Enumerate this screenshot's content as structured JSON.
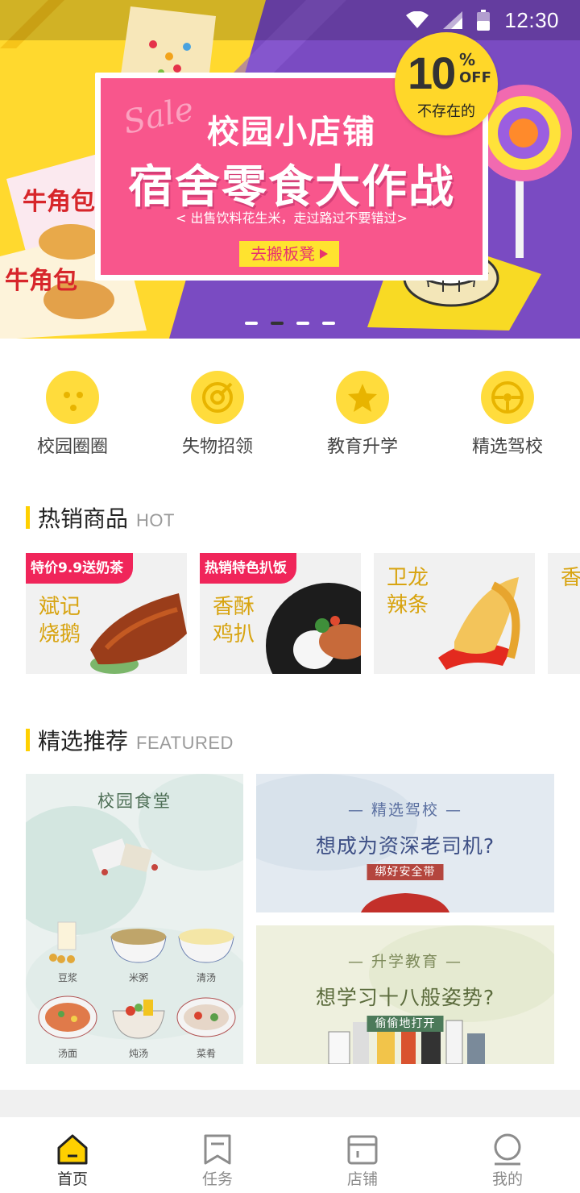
{
  "status_bar": {
    "time": "12:30"
  },
  "banner": {
    "sale_script": "Sale",
    "title": "校园小店铺",
    "headline": "宿舍零食大作战",
    "subtitle": "< 出售饮料花生米，走过路过不要错过>",
    "cta": "去搬板凳",
    "discount_number": "10",
    "discount_percent": "%",
    "discount_off": "OFF",
    "discount_note": "不存在的",
    "product_brand": "牛角包",
    "slide_count": 4,
    "active_slide": 2,
    "colors": {
      "yellow": "#ffd92e",
      "purple": "#7a4bc2",
      "pink": "#f8568c"
    }
  },
  "quick_nav": [
    {
      "label": "校园圈圈",
      "icon": "campus-circle-icon"
    },
    {
      "label": "失物招领",
      "icon": "lost-found-icon"
    },
    {
      "label": "教育升学",
      "icon": "education-star-icon"
    },
    {
      "label": "精选驾校",
      "icon": "steering-wheel-icon"
    }
  ],
  "hot": {
    "title": "热销商品",
    "subtitle": "HOT",
    "items": [
      {
        "tag": "特价9.9送奶茶",
        "name": "斌记烧鹅"
      },
      {
        "tag": "热销特色扒饭",
        "name": "香酥鸡扒"
      },
      {
        "tag": "",
        "name": "卫龙辣条"
      },
      {
        "tag": "",
        "name": "香子"
      }
    ]
  },
  "featured": {
    "title": "精选推荐",
    "subtitle": "FEATURED",
    "canteen": {
      "title": "校园食堂",
      "foods": [
        "豆浆",
        "米粥",
        "清汤",
        "汤面",
        "炖汤",
        "菜肴"
      ]
    },
    "cards": [
      {
        "kicker": "— 精选驾校 —",
        "title": "想成为资深老司机?",
        "button": "绑好安全带"
      },
      {
        "kicker": "— 升学教育 —",
        "title": "想学习十八般姿势?",
        "button": "偷偷地打开"
      }
    ]
  },
  "tab_bar": [
    {
      "label": "首页",
      "icon": "home-icon",
      "active": true
    },
    {
      "label": "任务",
      "icon": "bookmark-icon",
      "active": false
    },
    {
      "label": "店铺",
      "icon": "store-icon",
      "active": false
    },
    {
      "label": "我的",
      "icon": "profile-icon",
      "active": false
    }
  ]
}
